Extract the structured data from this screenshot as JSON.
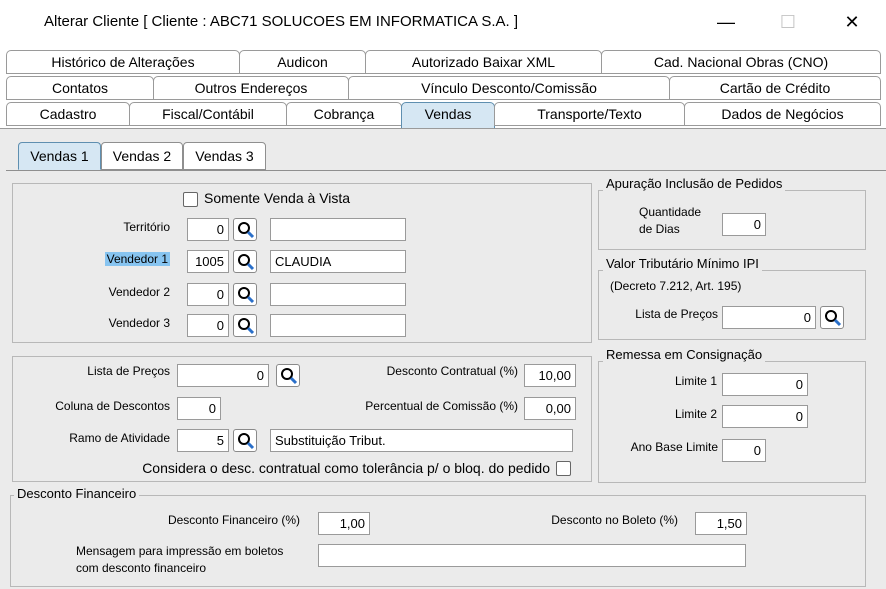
{
  "window": {
    "title": "Alterar Cliente [ Cliente : ABC71 SOLUCOES EM INFORMATICA S.A. ]",
    "minimize_glyph": "—",
    "maximize_glyph": "☐",
    "close_glyph": "✕"
  },
  "tabs": {
    "row1": [
      "Histórico de Alterações",
      "Audicon",
      "Autorizado Baixar XML",
      "Cad. Nacional Obras (CNO)"
    ],
    "row2": [
      "Contatos",
      "Outros Endereços",
      "Vínculo Desconto/Comissão",
      "Cartão de Crédito"
    ],
    "row3": [
      "Cadastro",
      "Fiscal/Contábil",
      "Cobrança",
      "Vendas",
      "Transporte/Texto",
      "Dados de Negócios"
    ],
    "active": "Vendas"
  },
  "subtabs": {
    "items": [
      "Vendas 1",
      "Vendas 2",
      "Vendas 3"
    ],
    "active": "Vendas 1"
  },
  "vendedores": {
    "somente_venda_vista_label": "Somente Venda à Vista",
    "territorio": {
      "label": "Território",
      "code": "0",
      "name": ""
    },
    "vendedor1": {
      "label": "Vendedor 1",
      "code": "1005",
      "name": "CLAUDIA"
    },
    "vendedor2": {
      "label": "Vendedor 2",
      "code": "0",
      "name": ""
    },
    "vendedor3": {
      "label": "Vendedor 3",
      "code": "0",
      "name": ""
    }
  },
  "precos": {
    "lista_precos_label": "Lista de Preços",
    "lista_precos_value": "0",
    "coluna_descontos_label": "Coluna de Descontos",
    "coluna_descontos_value": "0",
    "ramo_atividade_label": "Ramo de Atividade",
    "ramo_atividade_code": "5",
    "ramo_atividade_name": "Substituição Tribut.",
    "desconto_contratual_label": "Desconto Contratual (%)",
    "desconto_contratual_value": "10,00",
    "percentual_comissao_label": "Percentual de Comissão (%)",
    "percentual_comissao_value": "0,00",
    "considera_label": "Considera o desc. contratual como tolerância p/ o bloq. do pedido"
  },
  "apuracao": {
    "title": "Apuração Inclusão de Pedidos",
    "quantidade_label_1": "Quantidade",
    "quantidade_label_2": "de Dias",
    "quantidade_value": "0"
  },
  "ipi": {
    "title": "Valor Tributário Mínimo IPI",
    "decreto": "(Decreto 7.212, Art. 195)",
    "lista_precos_label": "Lista de Preços",
    "lista_precos_value": "0"
  },
  "consignacao": {
    "title": "Remessa em Consignação",
    "limite1_label": "Limite 1",
    "limite1_value": "0",
    "limite2_label": "Limite 2",
    "limite2_value": "0",
    "ano_base_label": "Ano Base Limite",
    "ano_base_value": "0"
  },
  "desconto_financeiro": {
    "title": "Desconto Financeiro",
    "desconto_label": "Desconto Financeiro (%)",
    "desconto_value": "1,00",
    "boleto_label": "Desconto no Boleto  (%)",
    "boleto_value": "1,50",
    "mensagem_label_1": "Mensagem para impressão em boletos",
    "mensagem_label_2": "com desconto financeiro",
    "mensagem_value": ""
  }
}
